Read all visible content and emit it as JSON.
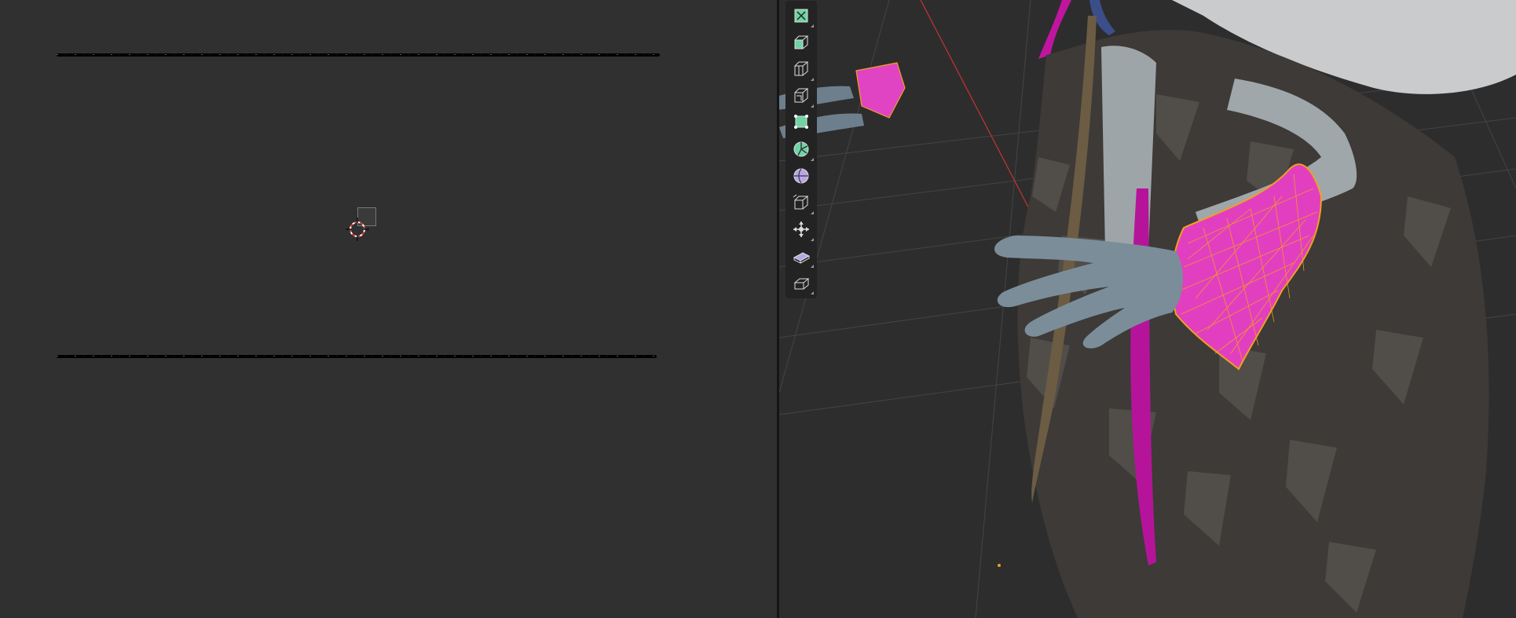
{
  "uv_editor": {
    "panel": "uv-editor"
  },
  "viewport": {
    "panel": "3d-viewport"
  },
  "toolbar": {
    "tools": [
      {
        "name": "extrude-region-tool",
        "icon": "extrude-region-icon"
      },
      {
        "name": "extrude-manifold-tool",
        "icon": "extrude-manifold-icon"
      },
      {
        "name": "inset-faces-tool",
        "icon": "inset-faces-icon"
      },
      {
        "name": "bevel-tool",
        "icon": "bevel-icon"
      },
      {
        "name": "loop-cut-tool",
        "icon": "loop-cut-icon"
      },
      {
        "name": "spin-tool",
        "icon": "spin-icon"
      },
      {
        "name": "smooth-tool",
        "icon": "smooth-icon"
      },
      {
        "name": "edge-slide-tool",
        "icon": "edge-slide-icon"
      },
      {
        "name": "shrink-fatten-tool",
        "icon": "shrink-fatten-icon"
      },
      {
        "name": "shear-tool",
        "icon": "shear-icon"
      },
      {
        "name": "rip-region-tool",
        "icon": "rip-region-icon"
      }
    ]
  },
  "colors": {
    "background": "#303030",
    "selection_face": "#e23fc0",
    "selection_edge": "#f0a020",
    "tool_green": "#6fd3a6",
    "tool_purple": "#b9a6e6"
  }
}
